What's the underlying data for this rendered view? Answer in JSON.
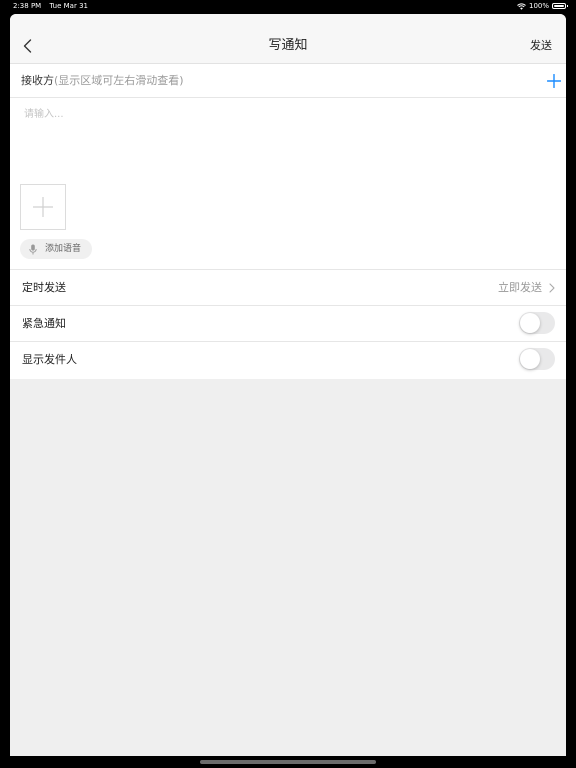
{
  "status_bar": {
    "time": "2:38 PM",
    "date": "Tue Mar 31",
    "battery": "100%"
  },
  "nav": {
    "title": "写通知",
    "send_label": "发送"
  },
  "recipient": {
    "label": "接收方",
    "hint": "(显示区域可左右滑动查看)"
  },
  "message": {
    "placeholder": "请输入...",
    "value": ""
  },
  "voice": {
    "label": "添加语音"
  },
  "settings": {
    "schedule": {
      "label": "定时发送",
      "value": "立即发送"
    },
    "urgent": {
      "label": "紧急通知",
      "on": false
    },
    "show_sender": {
      "label": "显示发件人",
      "on": false
    }
  },
  "colors": {
    "accent": "#1a8cff",
    "background": "#efefef",
    "toggle_off": "#e9e9ea"
  },
  "icons": {
    "back": "chevron-left-icon",
    "add_recipient": "plus-icon",
    "add_image": "plus-icon",
    "voice": "microphone-icon",
    "schedule": "chevron-right-icon",
    "wifi": "wifi-icon",
    "battery": "battery-icon"
  }
}
